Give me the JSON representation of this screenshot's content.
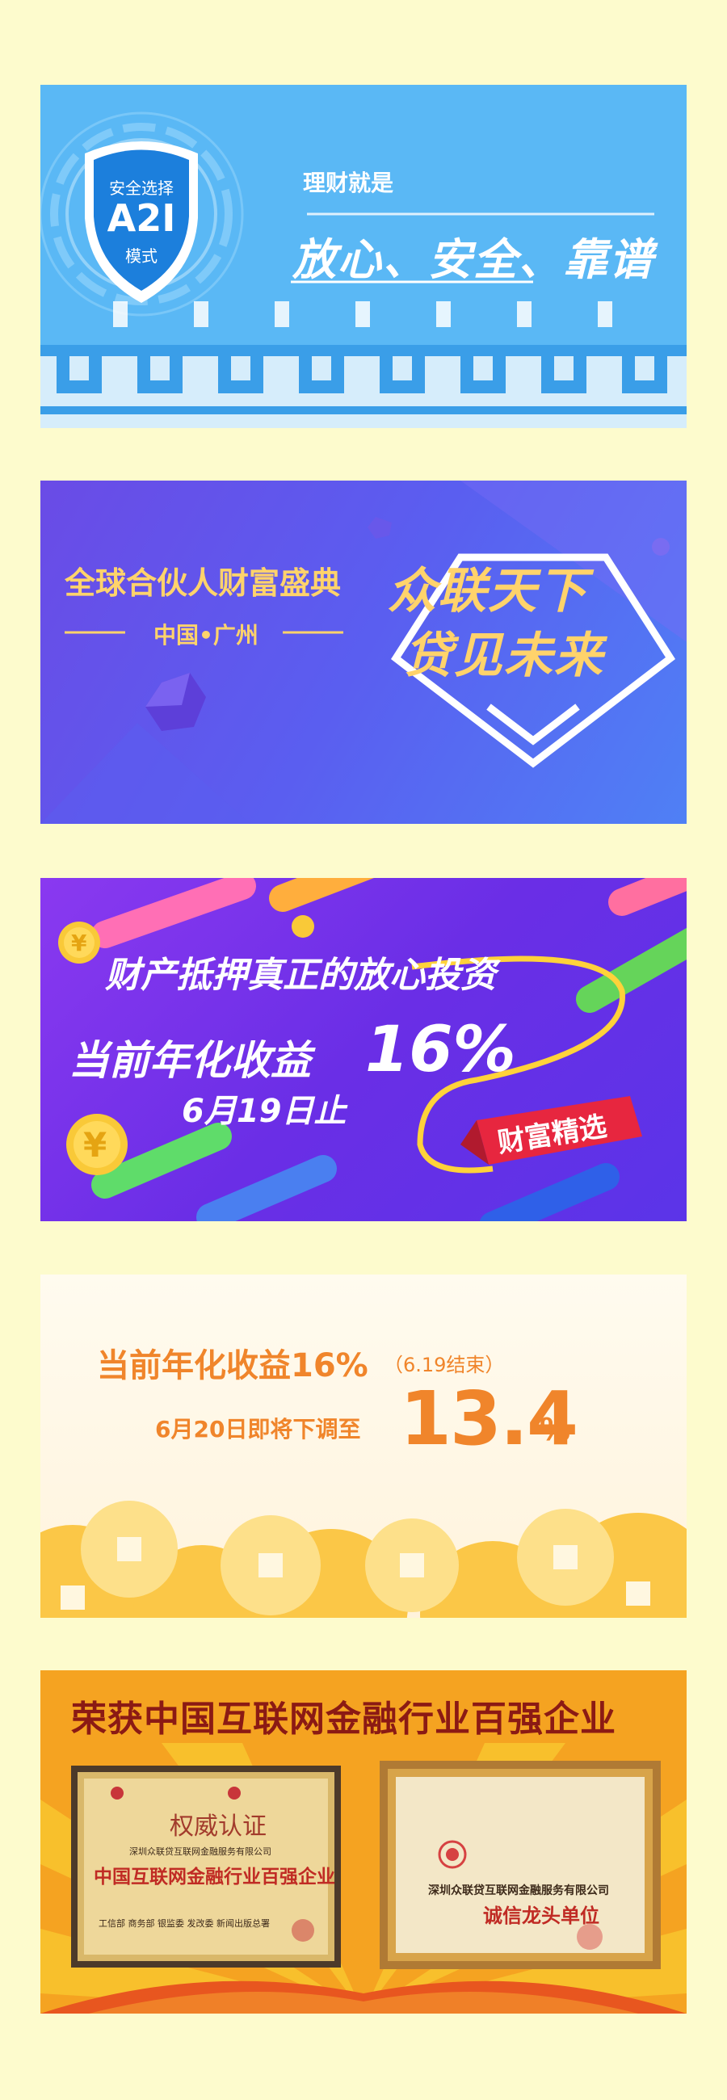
{
  "banners": {
    "b1": {
      "shield_line1": "安全选择",
      "shield_line2": "A2I",
      "shield_line3": "模式",
      "tagline": "理财就是",
      "headline": "放心、安全、靠谱",
      "colors": {
        "bg": "#5ab8f5",
        "accent": "#ffffff"
      }
    },
    "b2": {
      "title": "全球合伙人财富盛典",
      "subtitle": "中国•广州",
      "headline_line1": "众联天下",
      "headline_line2": "贷见未来",
      "colors": {
        "text": "#ffd36b"
      }
    },
    "b3": {
      "line1": "财产抵押真正的放心投资",
      "line2_prefix": "当前年化收益",
      "line2_rate": "16%",
      "line3": "6月19日止",
      "badge": "财富精选",
      "coin_symbol": "¥"
    },
    "b4": {
      "line1": "当前年化收益16%",
      "line1_note": "（6.19结束）",
      "line2": "6月20日即将下调至",
      "rate_value": "13.4",
      "rate_unit": "%",
      "colors": {
        "text": "#f0852b"
      }
    },
    "b5": {
      "title": "荣获中国互联网金融行业百强企业",
      "cert1": {
        "header": "权威认证",
        "company": "深圳众联贷互联网金融服务有限公司",
        "main": "中国互联网金融行业百强企业",
        "footer": "工信部  商务部  银监委  发改委  新闻出版总署"
      },
      "cert2": {
        "company": "深圳众联贷互联网金融服务有限公司",
        "main": "诚信龙头单位"
      }
    }
  }
}
